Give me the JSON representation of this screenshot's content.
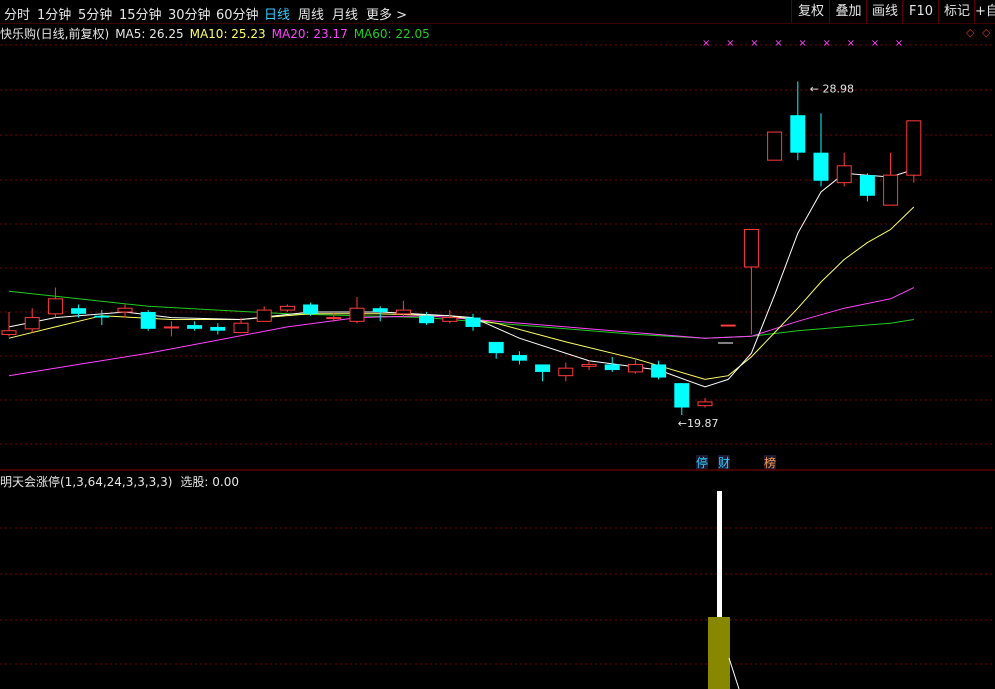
{
  "toolbar": {
    "tabs": [
      "分时",
      "1分钟",
      "5分钟",
      "15分钟",
      "30分钟",
      "60分钟",
      "日线",
      "周线",
      "月线",
      "更多 >"
    ],
    "active_tab": "日线",
    "right_buttons": [
      "复权",
      "叠加",
      "画线",
      "F10",
      "标记",
      "+自"
    ]
  },
  "info": {
    "title": "快乐购(日线,前复权)",
    "ma5": "MA5: 26.25",
    "ma10": "MA10: 25.23",
    "ma20": "MA20: 23.17",
    "ma60": "MA60: 22.05"
  },
  "colors": {
    "up": "#ff3c3c",
    "down": "#00ffff",
    "ma5": "#ffffff",
    "ma10": "#ffff66",
    "ma20": "#ff44ff",
    "ma60": "#22cc22",
    "grid": "#7a0000",
    "indicator_bar": "#888800"
  },
  "annotations": {
    "high_label": "28.98",
    "low_label": "19.87",
    "markers": [
      "停",
      "财",
      "榜"
    ]
  },
  "indicator": {
    "title": "明天会涨停(1,3,64,24,3,3,3,3)",
    "select_label": "选股: 0.00"
  },
  "chart_data": {
    "type": "candlestick",
    "ylim": [
      19.3,
      30.0
    ],
    "candles": [
      {
        "o": 22.25,
        "c": 22.35,
        "h": 22.85,
        "l": 22.2
      },
      {
        "o": 22.4,
        "c": 22.7,
        "h": 22.95,
        "l": 22.3
      },
      {
        "o": 22.8,
        "c": 23.2,
        "h": 23.5,
        "l": 22.7
      },
      {
        "o": 22.95,
        "c": 22.8,
        "h": 23.05,
        "l": 22.7
      },
      {
        "o": 22.75,
        "c": 22.7,
        "h": 22.9,
        "l": 22.5
      },
      {
        "o": 22.85,
        "c": 22.95,
        "h": 23.05,
        "l": 22.7
      },
      {
        "o": 22.85,
        "c": 22.4,
        "h": 22.9,
        "l": 22.35
      },
      {
        "o": 22.45,
        "c": 22.45,
        "h": 22.6,
        "l": 22.2
      },
      {
        "o": 22.5,
        "c": 22.4,
        "h": 22.6,
        "l": 22.35
      },
      {
        "o": 22.45,
        "c": 22.35,
        "h": 22.55,
        "l": 22.25
      },
      {
        "o": 22.3,
        "c": 22.55,
        "h": 22.7,
        "l": 22.3
      },
      {
        "o": 22.6,
        "c": 22.9,
        "h": 23.0,
        "l": 22.6
      },
      {
        "o": 22.9,
        "c": 23.0,
        "h": 23.05,
        "l": 22.85
      },
      {
        "o": 23.05,
        "c": 22.8,
        "h": 23.1,
        "l": 22.75
      },
      {
        "o": 22.7,
        "c": 22.7,
        "h": 22.85,
        "l": 22.6
      },
      {
        "o": 22.6,
        "c": 22.95,
        "h": 23.25,
        "l": 22.55
      },
      {
        "o": 22.95,
        "c": 22.85,
        "h": 23.0,
        "l": 22.6
      },
      {
        "o": 22.8,
        "c": 22.9,
        "h": 23.15,
        "l": 22.7
      },
      {
        "o": 22.75,
        "c": 22.55,
        "h": 22.85,
        "l": 22.5
      },
      {
        "o": 22.6,
        "c": 22.7,
        "h": 22.9,
        "l": 22.55
      },
      {
        "o": 22.7,
        "c": 22.45,
        "h": 22.8,
        "l": 22.35
      },
      {
        "o": 22.05,
        "c": 21.75,
        "h": 22.05,
        "l": 21.6
      },
      {
        "o": 21.7,
        "c": 21.55,
        "h": 21.8,
        "l": 21.45
      },
      {
        "o": 21.45,
        "c": 21.25,
        "h": 21.45,
        "l": 21.0
      },
      {
        "o": 21.15,
        "c": 21.35,
        "h": 21.5,
        "l": 21.0
      },
      {
        "o": 21.4,
        "c": 21.45,
        "h": 21.55,
        "l": 21.3
      },
      {
        "o": 21.45,
        "c": 21.3,
        "h": 21.65,
        "l": 21.25
      },
      {
        "o": 21.25,
        "c": 21.45,
        "h": 21.6,
        "l": 21.2
      },
      {
        "o": 21.45,
        "c": 21.1,
        "h": 21.55,
        "l": 21.05
      },
      {
        "o": 20.95,
        "c": 20.3,
        "h": 20.95,
        "l": 20.1
      },
      {
        "o": 20.35,
        "c": 20.45,
        "h": 20.55,
        "l": 20.3
      },
      {
        "o": 22.5,
        "c": 22.5,
        "h": 22.5,
        "l": 22.5
      },
      {
        "o": 24.05,
        "c": 25.05,
        "h": 25.05,
        "l": 22.25
      },
      {
        "o": 26.9,
        "c": 27.65,
        "h": 27.65,
        "l": 26.9
      },
      {
        "o": 28.1,
        "c": 27.1,
        "h": 29.0,
        "l": 26.9
      },
      {
        "o": 27.1,
        "c": 26.35,
        "h": 28.15,
        "l": 26.2
      },
      {
        "o": 26.3,
        "c": 26.75,
        "h": 27.1,
        "l": 26.2
      },
      {
        "o": 26.5,
        "c": 25.95,
        "h": 26.55,
        "l": 25.8
      },
      {
        "o": 25.7,
        "c": 26.5,
        "h": 27.1,
        "l": 25.7
      },
      {
        "o": 26.5,
        "c": 27.95,
        "h": 27.95,
        "l": 26.3
      }
    ],
    "ma5": [
      [
        0,
        22.45
      ],
      [
        2,
        22.7
      ],
      [
        5,
        22.85
      ],
      [
        7,
        22.7
      ],
      [
        10,
        22.65
      ],
      [
        13,
        22.85
      ],
      [
        16,
        22.85
      ],
      [
        19,
        22.75
      ],
      [
        20,
        22.7
      ],
      [
        22,
        22.15
      ],
      [
        25,
        21.55
      ],
      [
        28,
        21.3
      ],
      [
        30,
        20.85
      ],
      [
        31,
        21.05
      ],
      [
        32,
        21.75
      ],
      [
        33,
        23.3
      ],
      [
        34,
        24.95
      ],
      [
        35,
        26.05
      ],
      [
        36,
        26.55
      ],
      [
        37,
        26.5
      ],
      [
        38,
        26.45
      ],
      [
        39,
        26.65
      ]
    ],
    "ma10": [
      [
        0,
        22.15
      ],
      [
        2,
        22.45
      ],
      [
        4,
        22.75
      ],
      [
        7,
        22.65
      ],
      [
        10,
        22.65
      ],
      [
        13,
        22.8
      ],
      [
        16,
        22.8
      ],
      [
        19,
        22.75
      ],
      [
        21,
        22.55
      ],
      [
        24,
        22.05
      ],
      [
        27,
        21.6
      ],
      [
        30,
        21.05
      ],
      [
        31,
        21.15
      ],
      [
        32,
        21.65
      ],
      [
        33,
        22.3
      ],
      [
        34,
        22.95
      ],
      [
        35,
        23.65
      ],
      [
        36,
        24.25
      ],
      [
        37,
        24.7
      ],
      [
        38,
        25.05
      ],
      [
        39,
        25.65
      ]
    ],
    "ma20": [
      [
        0,
        21.15
      ],
      [
        3,
        21.45
      ],
      [
        6,
        21.75
      ],
      [
        9,
        22.1
      ],
      [
        12,
        22.45
      ],
      [
        15,
        22.7
      ],
      [
        18,
        22.75
      ],
      [
        21,
        22.6
      ],
      [
        24,
        22.45
      ],
      [
        27,
        22.3
      ],
      [
        30,
        22.15
      ],
      [
        32,
        22.2
      ],
      [
        34,
        22.6
      ],
      [
        36,
        22.95
      ],
      [
        38,
        23.2
      ],
      [
        39,
        23.5
      ]
    ],
    "ma60": [
      [
        0,
        23.4
      ],
      [
        3,
        23.2
      ],
      [
        6,
        23.0
      ],
      [
        9,
        22.9
      ],
      [
        12,
        22.8
      ],
      [
        15,
        22.75
      ],
      [
        18,
        22.7
      ],
      [
        21,
        22.55
      ],
      [
        24,
        22.4
      ],
      [
        27,
        22.25
      ],
      [
        30,
        22.15
      ],
      [
        32,
        22.2
      ],
      [
        34,
        22.35
      ],
      [
        36,
        22.45
      ],
      [
        38,
        22.55
      ],
      [
        39,
        22.65
      ]
    ],
    "indicator_signal_index": 30
  }
}
